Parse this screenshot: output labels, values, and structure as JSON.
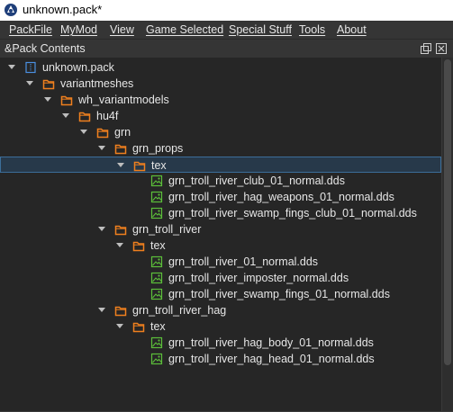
{
  "window": {
    "title": "unknown.pack*"
  },
  "menu": [
    {
      "label": "PackFile"
    },
    {
      "label": "MyMod"
    },
    {
      "label": "View"
    },
    {
      "label": "Game Selected"
    },
    {
      "label": "Special Stuff"
    },
    {
      "label": "Tools"
    },
    {
      "label": "About"
    }
  ],
  "dock": {
    "title": "&Pack Contents"
  },
  "tree": [
    {
      "label": "unknown.pack",
      "icon": "pack-icon",
      "depth": 0,
      "expanded": true
    },
    {
      "label": "variantmeshes",
      "icon": "folder-icon",
      "depth": 1,
      "expanded": true
    },
    {
      "label": "wh_variantmodels",
      "icon": "folder-icon",
      "depth": 2,
      "expanded": true
    },
    {
      "label": "hu4f",
      "icon": "folder-icon",
      "depth": 3,
      "expanded": true
    },
    {
      "label": "grn",
      "icon": "folder-icon",
      "depth": 4,
      "expanded": true
    },
    {
      "label": "grn_props",
      "icon": "folder-icon",
      "depth": 5,
      "expanded": true
    },
    {
      "label": "tex",
      "icon": "folder-icon",
      "depth": 6,
      "expanded": true,
      "selected": true
    },
    {
      "label": "grn_troll_river_club_01_normal.dds",
      "icon": "image-file-icon",
      "depth": 7
    },
    {
      "label": "grn_troll_river_hag_weapons_01_normal.dds",
      "icon": "image-file-icon",
      "depth": 7
    },
    {
      "label": "grn_troll_river_swamp_fings_club_01_normal.dds",
      "icon": "image-file-icon",
      "depth": 7
    },
    {
      "label": "grn_troll_river",
      "icon": "folder-icon",
      "depth": 5,
      "expanded": true
    },
    {
      "label": "tex",
      "icon": "folder-icon",
      "depth": 6,
      "expanded": true
    },
    {
      "label": "grn_troll_river_01_normal.dds",
      "icon": "image-file-icon",
      "depth": 7
    },
    {
      "label": "grn_troll_river_imposter_normal.dds",
      "icon": "image-file-icon",
      "depth": 7
    },
    {
      "label": "grn_troll_river_swamp_fings_01_normal.dds",
      "icon": "image-file-icon",
      "depth": 7
    },
    {
      "label": "grn_troll_river_hag",
      "icon": "folder-icon",
      "depth": 5,
      "expanded": true
    },
    {
      "label": "tex",
      "icon": "folder-icon",
      "depth": 6,
      "expanded": true
    },
    {
      "label": "grn_troll_river_hag_body_01_normal.dds",
      "icon": "image-file-icon",
      "depth": 7
    },
    {
      "label": "grn_troll_river_hag_head_01_normal.dds",
      "icon": "image-file-icon",
      "depth": 7
    }
  ],
  "colors": {
    "folder": "#f0801e",
    "image_file": "#5cbf3a",
    "pack": "#4a90e2",
    "selection_border": "#3c6e9a"
  }
}
